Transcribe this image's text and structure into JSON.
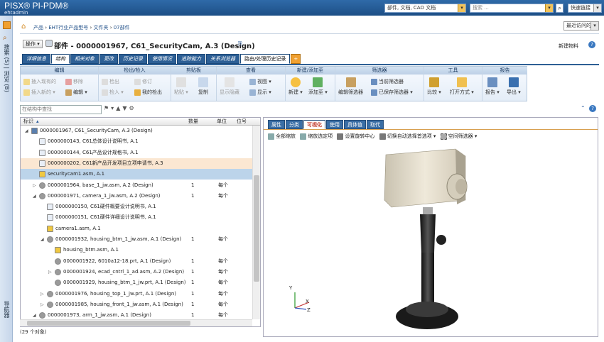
{
  "app": {
    "brand": "PISX® PI-PDM®",
    "user": "ehtadmin"
  },
  "top": {
    "search_scope": "部件, 文档, CAD 文档",
    "search_placeholder": "搜索 ...",
    "quick_links": "快速链接"
  },
  "left_rail": {
    "search_label": "搜索 (S) | 浏览 (B)",
    "nav_label": "导航器"
  },
  "breadcrumb": {
    "items": [
      "产品",
      "EHT行业产品型号",
      "文件夹",
      "07部件"
    ],
    "recent": "最近访问的"
  },
  "title": {
    "actions": "操作",
    "label": "部件 - 0000001967, C61_SecurityCam, A.3 (Design)",
    "new_object": "新建物料"
  },
  "tabs": [
    "详细信息",
    "结构",
    "相关对象",
    "更改",
    "历史记录",
    "使用情况",
    "追踪能力",
    "关系浏览器",
    "路由/处理历史记录"
  ],
  "tabs_selected": 1,
  "ribbon": {
    "groups": [
      "编辑",
      "检出/检入",
      "剪贴板",
      "查看",
      "新建/添加至",
      "筛选器",
      "工具",
      "报告"
    ],
    "edit": [
      "插入现有的",
      "插入新的",
      "移除",
      "编辑"
    ],
    "checkout": [
      "检出",
      "检入",
      "修订",
      "我的检出"
    ],
    "clipboard": [
      "粘贴",
      "复制"
    ],
    "view": [
      "显示隐藏",
      "视图",
      "显示"
    ],
    "new": [
      "新建",
      "添加至"
    ],
    "filter": [
      "编辑筛选器",
      "当前筛选器",
      "已保存筛选器"
    ],
    "tools": [
      "比较",
      "打开方式"
    ],
    "report": [
      "报告",
      "导出"
    ]
  },
  "find_placeholder": "在结构中查找",
  "tree": {
    "columns": [
      "标识",
      "数量",
      "单位",
      "位号"
    ],
    "rows": [
      {
        "indent": 0,
        "exp": "◢",
        "icon": "assembly",
        "text": "0000001967, C61_SecurityCam, A.3 (Design)",
        "qty": "",
        "unit": ""
      },
      {
        "indent": 1,
        "exp": "",
        "icon": "doc",
        "text": "0000000143, C61总体设计说明书, A.1",
        "qty": "",
        "unit": ""
      },
      {
        "indent": 1,
        "exp": "",
        "icon": "doc",
        "text": "0000000144, C61产品设计规格书, A.1",
        "qty": "",
        "unit": ""
      },
      {
        "indent": 1,
        "exp": "",
        "icon": "doc",
        "text": "0000000202, C61新产品开发项目立项申请书, A.3",
        "qty": "",
        "unit": "",
        "hl": "orange"
      },
      {
        "indent": 1,
        "exp": "",
        "icon": "cad",
        "text": "securitycam1.asm, A.1",
        "qty": "",
        "unit": "",
        "hl": "blue"
      },
      {
        "indent": 1,
        "exp": "▷",
        "icon": "gear",
        "text": "0000001964, base_1_jw.asm, A.2 (Design)",
        "qty": "1",
        "unit": "每个"
      },
      {
        "indent": 1,
        "exp": "◢",
        "icon": "gear",
        "text": "0000001971, camera_1_jw.asm, A.2 (Design)",
        "qty": "1",
        "unit": "每个"
      },
      {
        "indent": 2,
        "exp": "",
        "icon": "doc",
        "text": "0000000150, C61硬件概要设计说明书, A.1",
        "qty": "",
        "unit": ""
      },
      {
        "indent": 2,
        "exp": "",
        "icon": "doc",
        "text": "0000000151, C61硬件详细设计说明书, A.1",
        "qty": "",
        "unit": ""
      },
      {
        "indent": 2,
        "exp": "",
        "icon": "cad",
        "text": "camera1.asm, A.1",
        "qty": "",
        "unit": ""
      },
      {
        "indent": 2,
        "exp": "◢",
        "icon": "gear",
        "text": "0000001932, housing_btm_1_jw.asm, A.1 (Design)",
        "qty": "1",
        "unit": "每个"
      },
      {
        "indent": 3,
        "exp": "",
        "icon": "cad",
        "text": "housing_btm.asm, A.1",
        "qty": "",
        "unit": ""
      },
      {
        "indent": 3,
        "exp": "",
        "icon": "gear",
        "text": "0000001922, 6010a12-18.prt, A.1 (Design)",
        "qty": "1",
        "unit": "每个"
      },
      {
        "indent": 3,
        "exp": "▷",
        "icon": "gear",
        "text": "0000001924, ecad_cntrl_1_ad.asm, A.2 (Design)",
        "qty": "1",
        "unit": "每个"
      },
      {
        "indent": 3,
        "exp": "",
        "icon": "gear",
        "text": "0000001929, housing_btm_1_jw.prt, A.1 (Design)",
        "qty": "1",
        "unit": "每个"
      },
      {
        "indent": 2,
        "exp": "▷",
        "icon": "gear",
        "text": "0000001976, housing_top_1_jw.prt, A.1 (Design)",
        "qty": "1",
        "unit": "每个"
      },
      {
        "indent": 2,
        "exp": "▷",
        "icon": "gear",
        "text": "0000001985, housing_front_1_jw.asm, A.1 (Design)",
        "qty": "1",
        "unit": "每个"
      },
      {
        "indent": 1,
        "exp": "◢",
        "icon": "gear",
        "text": "0000001973, arm_1_jw.asm, A.1 (Design)",
        "qty": "1",
        "unit": "每个"
      }
    ]
  },
  "status": "(29 个对象)",
  "right": {
    "tabs": [
      "属性",
      "分类",
      "可视化",
      "使用",
      "具体值",
      "取代"
    ],
    "tabs_selected": 2,
    "toolbar": [
      "全部缩放",
      "缩放选定项",
      "设置旋转中心",
      "切换自动选择首选项",
      "空间筛选器"
    ],
    "axes": {
      "y": "Y",
      "x": "X",
      "z": "Z"
    }
  }
}
